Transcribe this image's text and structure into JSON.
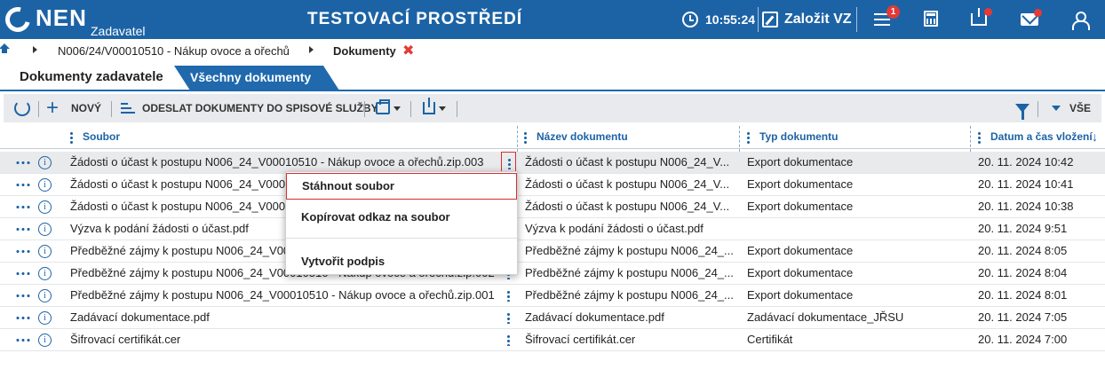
{
  "header": {
    "logo_text": "NEN",
    "logo_subtitle": "Zadavatel",
    "environment_title": "TESTOVACÍ PROSTŘEDÍ",
    "clock_time": "10:55:24",
    "create_label": "Založit VZ",
    "menu_badge": "1",
    "accent_color": "#1c63a6",
    "notification_color": "#e53935"
  },
  "breadcrumb": {
    "items": [
      "N006/24/V00010510 - Nákup ovoce a ořechů",
      "Dokumenty"
    ],
    "close_symbol": "✖"
  },
  "tabs": [
    {
      "label": "Dokumenty zadavatele",
      "active": true
    },
    {
      "label": "Všechny dokumenty",
      "active": false
    }
  ],
  "toolbar": {
    "new_label": "NOVÝ",
    "send_label": "ODESLAT DOKUMENTY DO SPISOVÉ SLUŽBY",
    "filter_label": "VŠE"
  },
  "table": {
    "columns": [
      "Soubor",
      "Název dokumentu",
      "Typ dokumentu",
      "Datum a čas vložení"
    ],
    "sort_indicator": "↓",
    "rows": [
      {
        "file": "Žádosti o účast k postupu N006_24_V00010510 - Nákup ovoce a ořechů.zip.003",
        "name": "Žádosti o účast k postupu N006_24_V...",
        "type": "Export dokumentace",
        "date": "20. 11. 2024 10:42"
      },
      {
        "file": "Žádosti o účast k postupu N006_24_V00010510 - Nákup ovoce a ořechů.zip.002",
        "name": "Žádosti o účast k postupu N006_24_V...",
        "type": "Export dokumentace",
        "date": "20. 11. 2024 10:41"
      },
      {
        "file": "Žádosti o účast k postupu N006_24_V00010510 - Nákup ovoce a ořechů.zip.001",
        "name": "Žádosti o účast k postupu N006_24_V...",
        "type": "Export dokumentace",
        "date": "20. 11. 2024 10:38"
      },
      {
        "file": "Výzva k podání žádosti o účast.pdf",
        "name": "Výzva k podání žádosti o účast.pdf",
        "type": "",
        "date": "20. 11. 2024 9:51"
      },
      {
        "file": "Předběžné zájmy k postupu N006_24_V00010510 - Nákup ovoce a ořechů.zip.003",
        "name": "Předběžné zájmy k postupu N006_24_...",
        "type": "Export dokumentace",
        "date": "20. 11. 2024 8:05"
      },
      {
        "file": "Předběžné zájmy k postupu N006_24_V00010510 - Nákup ovoce a ořechů.zip.002",
        "name": "Předběžné zájmy k postupu N006_24_...",
        "type": "Export dokumentace",
        "date": "20. 11. 2024 8:04"
      },
      {
        "file": "Předběžné zájmy k postupu N006_24_V00010510 - Nákup ovoce a ořechů.zip.001",
        "name": "Předběžné zájmy k postupu N006_24_...",
        "type": "Export dokumentace",
        "date": "20. 11. 2024 8:01"
      },
      {
        "file": "Zadávací dokumentace.pdf",
        "name": "Zadávací dokumentace.pdf",
        "type": "Zadávací dokumentace_JŘSU",
        "date": "20. 11. 2024 7:05"
      },
      {
        "file": "Šifrovací certifikát.cer",
        "name": "Šifrovací certifikát.cer",
        "type": "Certifikát",
        "date": "20. 11. 2024 7:00"
      }
    ]
  },
  "context_menu": {
    "items": [
      "Stáhnout soubor",
      "Kopírovat odkaz na soubor",
      "Vytvořit podpis"
    ]
  }
}
